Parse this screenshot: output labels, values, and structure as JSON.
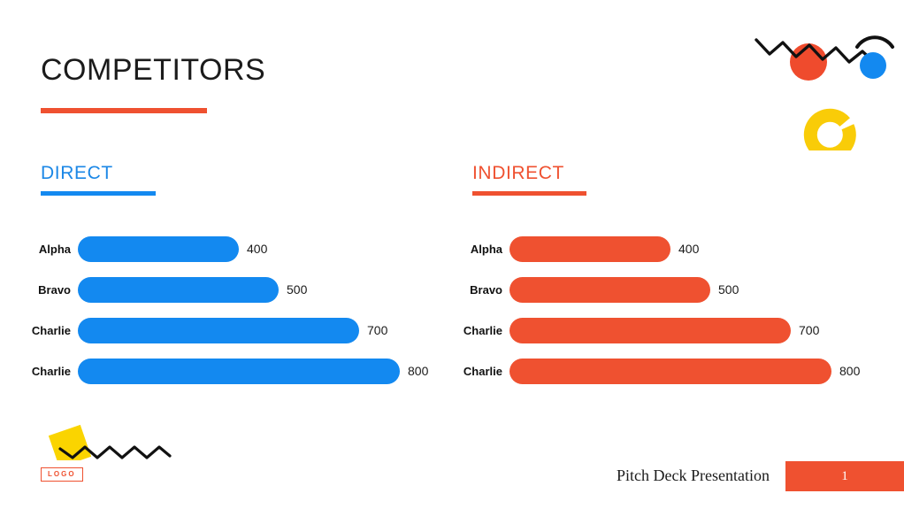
{
  "slide": {
    "title": "COMPETITORS",
    "logo_label": "LOGO"
  },
  "sections": {
    "direct": {
      "heading": "DIRECT",
      "color": "#1389f0"
    },
    "indirect": {
      "heading": "INDIRECT",
      "color": "#ef5130"
    }
  },
  "footer": {
    "text": "Pitch Deck Presentation",
    "page_number": "1",
    "page_box_color": "#ef5130"
  },
  "decorations": {
    "red_circle_color": "#ef4b2d",
    "blue_circle_color": "#1389f0",
    "yellow_color": "#f9cc08",
    "yellow_diamond_color": "#fad400",
    "zigzag_color": "#111111"
  },
  "chart_data": [
    {
      "type": "bar",
      "title": "DIRECT",
      "orientation": "horizontal",
      "categories": [
        "Alpha",
        "Bravo",
        "Charlie",
        "Charlie"
      ],
      "values": [
        400,
        500,
        700,
        800
      ],
      "value_labels": [
        "400",
        "500",
        "700",
        "800"
      ],
      "color": "#1389f0",
      "xlabel": "",
      "ylabel": "",
      "xlim": [
        0,
        800
      ],
      "grid": false,
      "legend": false
    },
    {
      "type": "bar",
      "title": "INDIRECT",
      "orientation": "horizontal",
      "categories": [
        "Alpha",
        "Bravo",
        "Charlie",
        "Charlie"
      ],
      "values": [
        400,
        500,
        700,
        800
      ],
      "value_labels": [
        "400",
        "500",
        "700",
        "800"
      ],
      "color": "#ef5130",
      "xlabel": "",
      "ylabel": "",
      "xlim": [
        0,
        800
      ],
      "grid": false,
      "legend": false
    }
  ]
}
